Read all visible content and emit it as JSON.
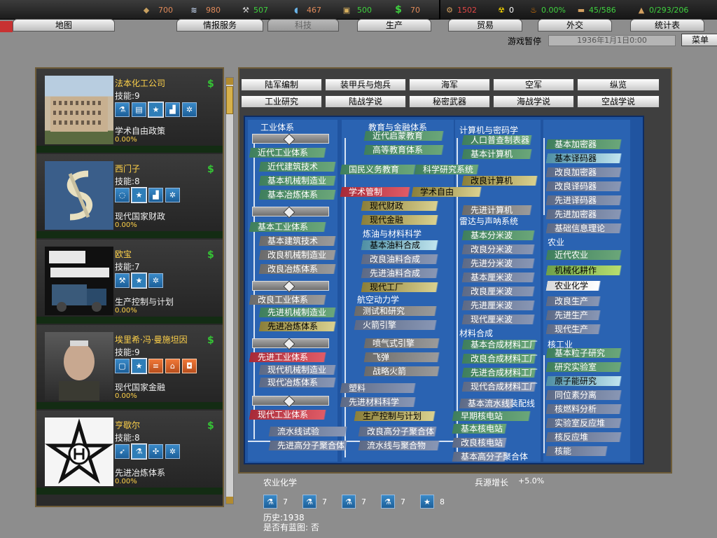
{
  "resources": [
    {
      "icon": "energy-icon",
      "glyph": "◆",
      "color": "#e08a5a",
      "value": "700"
    },
    {
      "icon": "metal-icon",
      "glyph": "≋",
      "color": "#e08a5a",
      "value": "980"
    },
    {
      "icon": "rare-materials-icon",
      "glyph": "⚒",
      "color": "#3fd23f",
      "value": "507"
    },
    {
      "icon": "oil-icon",
      "glyph": "💧",
      "color": "#e08a5a",
      "value": "467"
    },
    {
      "icon": "supplies-icon",
      "glyph": "▣",
      "color": "#3fd23f",
      "value": "500"
    },
    {
      "icon": "money-icon",
      "glyph": "$",
      "color": "#e08a5a",
      "value": "70"
    }
  ],
  "stats": [
    {
      "icon": "manpower-icon",
      "glyph": "⚙",
      "color": "#e04646",
      "value": "1502"
    },
    {
      "icon": "nuclear-icon",
      "glyph": "☢",
      "color": "#ffffff",
      "value": "0"
    },
    {
      "icon": "dissent-icon",
      "glyph": "🔥",
      "color": "#3fd23f",
      "value": "0.00%"
    },
    {
      "icon": "transport-icon",
      "glyph": "▬",
      "color": "#3fd23f",
      "value": "45/586"
    },
    {
      "icon": "industry-icon",
      "glyph": "▲",
      "color": "#3fd23f",
      "value": "0/293/206"
    }
  ],
  "tabs": [
    "地图",
    "情报服务",
    "科技",
    "生产",
    "贸易",
    "外交",
    "统计表"
  ],
  "status": {
    "paused": "游戏暂停",
    "date": "1936年1月1日0:00",
    "menu": "菜单"
  },
  "companies": [
    {
      "name": "法本化工公司",
      "skill": "技能:9",
      "desc": "学术自由政策",
      "pct": "0.00%",
      "icons": [
        "flask-icon",
        "scroll-icon",
        "star-icon",
        "factory-icon",
        "gears-icon"
      ]
    },
    {
      "name": "西门子",
      "skill": "技能:8",
      "desc": "现代国家财政",
      "pct": "0.00%",
      "icons": [
        "bulb-icon",
        "star-icon",
        "factory-icon",
        "gears-icon"
      ]
    },
    {
      "name": "欧宝",
      "skill": "技能:7",
      "desc": "生产控制与计划",
      "pct": "0.00%",
      "icons": [
        "wrench-icon",
        "star-icon",
        "gears-icon"
      ]
    },
    {
      "name": "埃里希·冯·曼施坦因",
      "skill": "技能:9",
      "desc": "现代国家金融",
      "pct": "0.00%",
      "icons": [
        "square-icon",
        "star-icon",
        "artillery-icon",
        "tent-icon",
        "vehicle-icon"
      ]
    },
    {
      "name": "亨歇尔",
      "skill": "技能:8",
      "desc": "先进冶炼体系",
      "pct": "0.00%",
      "icons": [
        "rocket-icon",
        "flask-icon",
        "propeller-icon",
        "gears-icon"
      ]
    }
  ],
  "categories": [
    "陆军编制",
    "装甲兵与炮兵",
    "海军",
    "空军",
    "纵览",
    "工业研究",
    "陆战学说",
    "秘密武器",
    "海战学说",
    "空战学说"
  ],
  "tree": {
    "sections": [
      "工业体系",
      "教育与金融体系",
      "计算机与密码学",
      "炼油与材料科学",
      "雷达与声呐系统",
      "航空动力学",
      "材料合成",
      "农业",
      "核工业"
    ],
    "nodes": [
      "近代工业体系",
      "近代建筑技术",
      "基本机械制造业",
      "基本冶炼体系",
      "基本工业体系",
      "基本建筑技术",
      "改良机械制造业",
      "改良冶炼体系",
      "改良工业体系",
      "先进机械制造业",
      "先进冶炼体系",
      "先进工业体系",
      "现代机械制造业",
      "现代冶炼体系",
      "现代工业体系",
      "近代启蒙教育",
      "高等教育体系",
      "国民义务教育",
      "科学研究系统",
      "学术管制",
      "学术自由",
      "现代财政",
      "现代金融",
      "基本油料合成",
      "改良油料合成",
      "先进油料合成",
      "现代工厂",
      "测试和研究",
      "火箭引擎",
      "喷气式引擎",
      "飞弹",
      "战略火箭",
      "塑料",
      "先进材料科学",
      "生产控制与计划",
      "人口普查制表器",
      "基本计算机",
      "改良计算机",
      "先进计算机",
      "基本加密器",
      "基本译码器",
      "改良加密器",
      "改良译码器",
      "先进译码器",
      "先进加密器",
      "基础信息理论",
      "基本分米波",
      "改良分米波",
      "先进分米波",
      "基本厘米波",
      "改良厘米波",
      "先进厘米波",
      "现代厘米波",
      "近代农业",
      "机械化耕作",
      "农业化学",
      "改良生产",
      "先进生产",
      "现代生产",
      "基本合成材料工厂",
      "改良合成材料工厂",
      "先进合成材料工厂",
      "现代合成材料工厂",
      "基本粒子研究",
      "研究实验室",
      "原子能研究",
      "同位素分离",
      "核燃料分析",
      "实验室反应堆",
      "核反应堆",
      "核能",
      "流水线试验",
      "基本流水线装配线",
      "早期核电站",
      "基本核电站",
      "改良核电站",
      "基本高分子聚合体",
      "改良高分子聚合体",
      "先进高分子聚合体",
      "流水线与聚合物"
    ]
  },
  "info": {
    "title": "农业化学",
    "bonus_label": "兵源增长",
    "bonus_value": "+5.0%",
    "mods": [
      {
        "icon": "flask-icon",
        "value": "7"
      },
      {
        "icon": "flask-icon",
        "value": "7"
      },
      {
        "icon": "flask-icon",
        "value": "7"
      },
      {
        "icon": "flask-icon",
        "value": "7"
      },
      {
        "icon": "star-icon",
        "value": "8"
      }
    ],
    "history": "历史:1938",
    "blueprint": "是否有蓝图: 否"
  }
}
